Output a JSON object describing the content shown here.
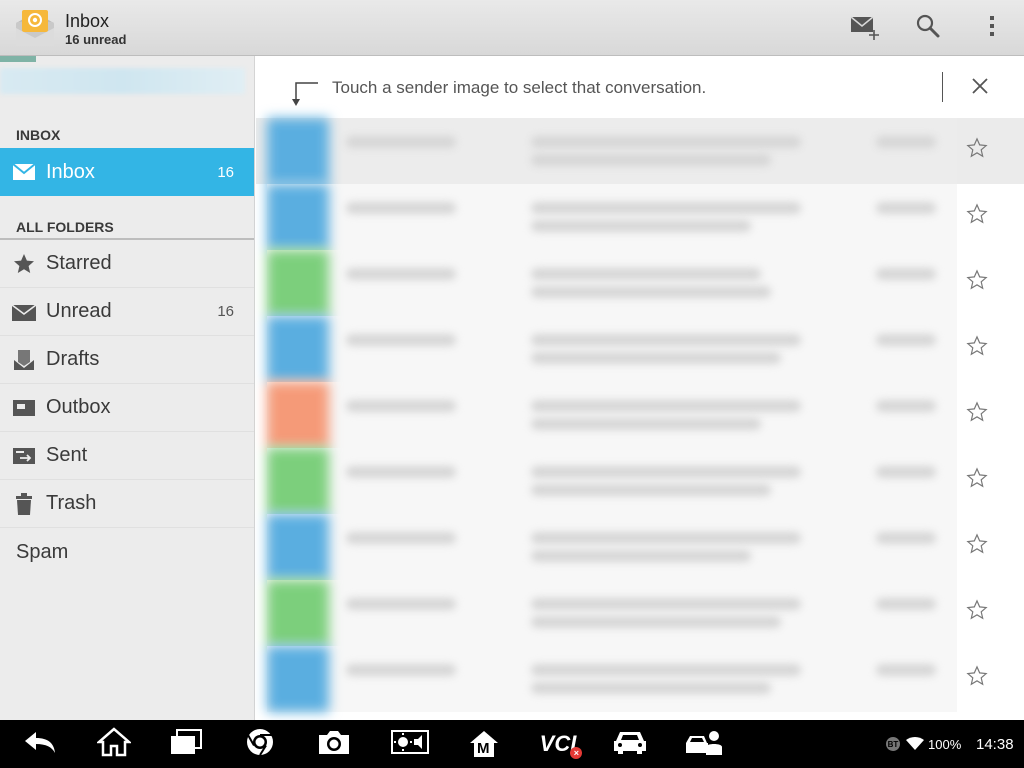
{
  "header": {
    "title": "Inbox",
    "subtitle": "16 unread",
    "actions": [
      "compose-icon",
      "search-icon",
      "overflow-menu-icon"
    ]
  },
  "sidebar": {
    "section_inbox": "INBOX",
    "inbox": {
      "label": "Inbox",
      "count": "16",
      "icon": "mail-icon"
    },
    "section_folders": "ALL FOLDERS",
    "folders": [
      {
        "label": "Starred",
        "count": "",
        "icon": "star-icon"
      },
      {
        "label": "Unread",
        "count": "16",
        "icon": "unread-mail-icon"
      },
      {
        "label": "Drafts",
        "count": "",
        "icon": "drafts-icon"
      },
      {
        "label": "Outbox",
        "count": "",
        "icon": "outbox-icon"
      },
      {
        "label": "Sent",
        "count": "",
        "icon": "sent-icon"
      },
      {
        "label": "Trash",
        "count": "",
        "icon": "trash-icon"
      },
      {
        "label": "Spam",
        "count": "",
        "icon": ""
      }
    ]
  },
  "hint": {
    "text": "Touch a sender image to select that conversation."
  },
  "conversations": [
    {
      "avatar_color": "#5aaee0"
    },
    {
      "avatar_color": "#5aaee0"
    },
    {
      "avatar_color": "#7ccf7c"
    },
    {
      "avatar_color": "#5aaee0"
    },
    {
      "avatar_color": "#f59a78"
    },
    {
      "avatar_color": "#7ccf7c"
    },
    {
      "avatar_color": "#5aaee0"
    },
    {
      "avatar_color": "#7ccf7c"
    },
    {
      "avatar_color": "#5aaee0"
    }
  ],
  "colors": {
    "accent": "#33b5e5",
    "sidebar_bg": "#ececec"
  },
  "system_bar": {
    "buttons": [
      "back-icon",
      "home-icon",
      "recent-apps-icon",
      "chrome-icon",
      "camera-icon",
      "brightness-volume-icon",
      "m-app-icon",
      "vci-icon",
      "car-icon",
      "mechanic-icon"
    ],
    "vci_label": "VCI",
    "m_label": "M",
    "bt_label": "BT",
    "battery": "100%",
    "clock": "14:38"
  }
}
